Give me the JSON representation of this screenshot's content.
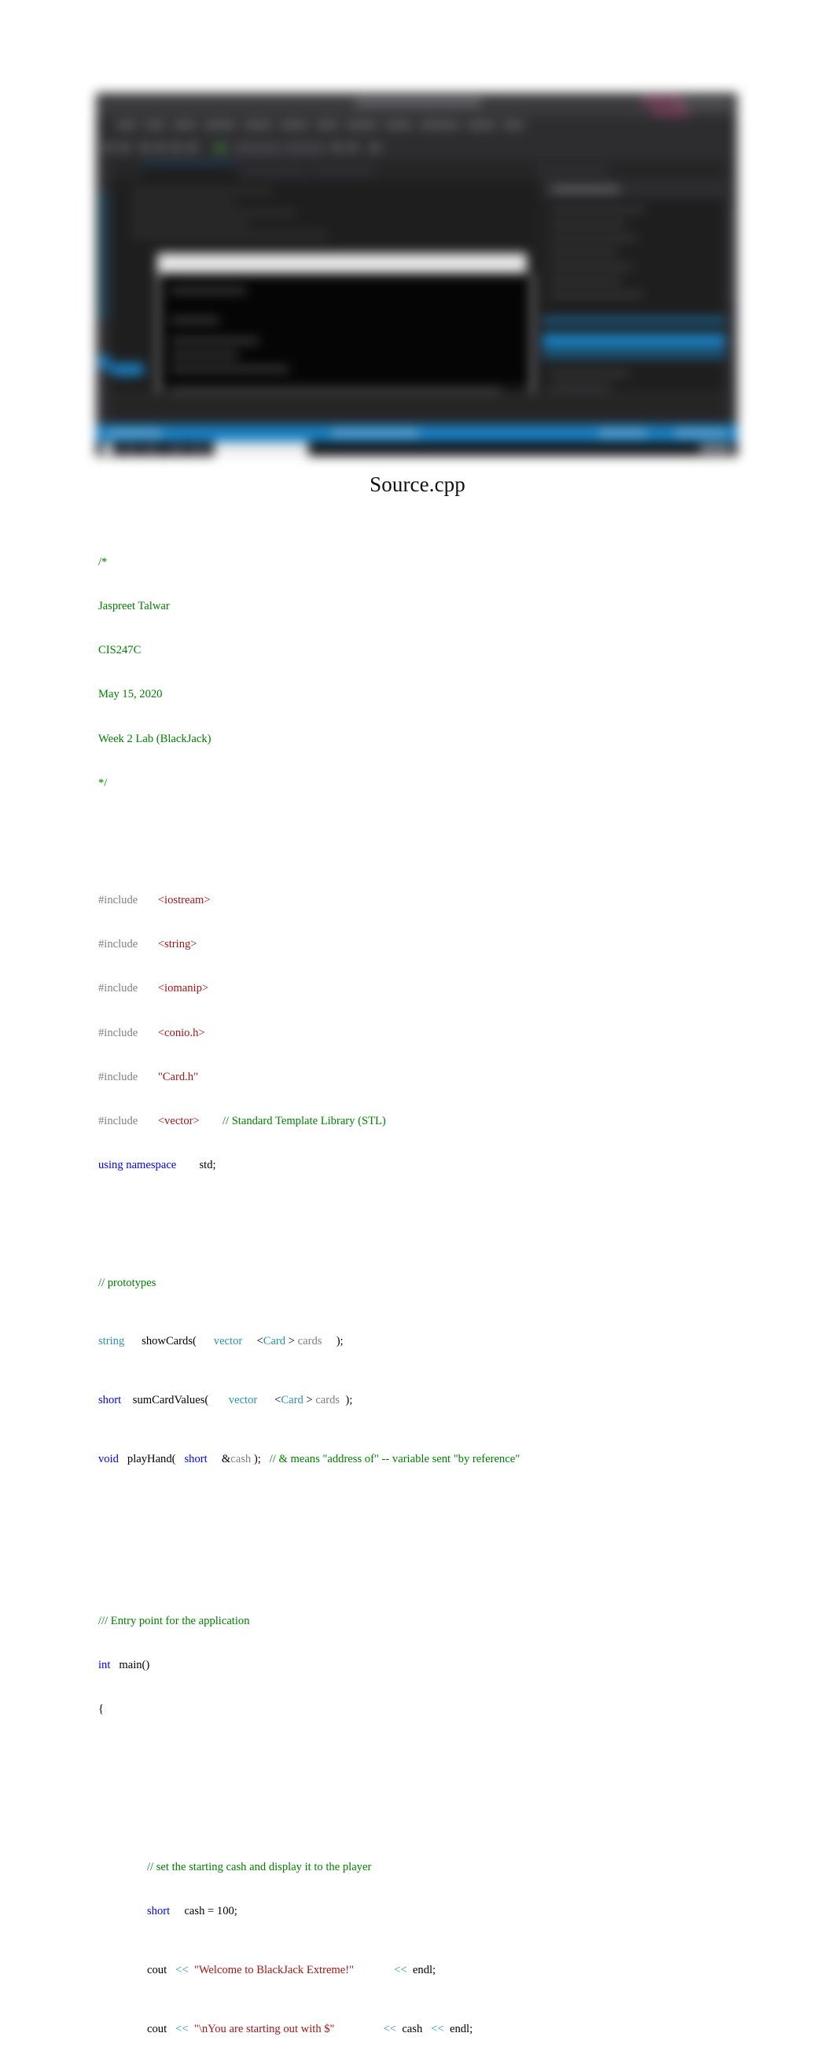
{
  "document": {
    "title": "Source.cpp"
  },
  "screenshot": {
    "alt_name": "visual-studio-ide-screenshot",
    "description": "Blurred Visual Studio IDE window with console output window, solution explorer panel and blue status bar",
    "accent_blue": "#1a7fc0",
    "editor_background": "#1e1e1e",
    "chrome_background": "#2d2d30"
  },
  "colors": {
    "comment": "#008000",
    "preprocessor": "#808080",
    "string": "#A31515",
    "keyword": "#0000FF",
    "type": "#2B91AF",
    "dim": "#808080",
    "plain": "#000000"
  },
  "code": {
    "header_comment": {
      "open": "/*",
      "author": "Jaspreet Talwar",
      "course": "CIS247C",
      "date": "May 15, 2020",
      "assignment": "Week 2 Lab (BlackJack)",
      "close": "*/"
    },
    "includes": [
      {
        "directive": "#include",
        "header": "<iostream>",
        "comment": ""
      },
      {
        "directive": "#include",
        "header": "<string>",
        "comment": ""
      },
      {
        "directive": "#include",
        "header": "<iomanip>",
        "comment": ""
      },
      {
        "directive": "#include",
        "header": "<conio.h>",
        "comment": ""
      },
      {
        "directive": "#include",
        "header": "\"Card.h\"",
        "comment": ""
      },
      {
        "directive": "#include",
        "header": "<vector>",
        "comment": "// Standard Template Library (STL)"
      }
    ],
    "using": {
      "keyword": "using namespace",
      "value": "std;"
    },
    "prototypes": {
      "comment": "// prototypes",
      "p1": {
        "ret": "string",
        "name": "showCards(",
        "vec": "vector",
        "lt": "<",
        "card": "Card",
        "gt": ">",
        "param": "cards",
        "end": ");"
      },
      "p2": {
        "ret": "short",
        "name": "sumCardValues(",
        "vec": "vector",
        "lt": "<",
        "card": "Card",
        "gt": ">",
        "param": "cards",
        "end": ");"
      },
      "p3": {
        "ret": "void",
        "name": "playHand(",
        "type": "short",
        "amp": "&",
        "param": "cash",
        "end": ");",
        "comment": "// & means \"address of\" -- variable sent \"by reference\""
      }
    },
    "main": {
      "entry_comment": "/// Entry point for the application",
      "ret": "int",
      "signature": "main()",
      "open_brace": "{",
      "body": {
        "cash_comment": "// set the starting cash and display it to the player",
        "cash_type": "short",
        "cash_decl": "cash = 100;",
        "line1": {
          "stream": "cout",
          "op1": "<<",
          "text": "\"Welcome to BlackJack Extreme!\"",
          "op2": "<<",
          "endl": "endl;"
        },
        "line2": {
          "stream": "cout",
          "op1": "<<",
          "text": "\"\\nYou are starting out with $\"",
          "op2": "<<",
          "var": "cash",
          "op3": "<<",
          "endl": "endl;"
        }
      }
    }
  }
}
